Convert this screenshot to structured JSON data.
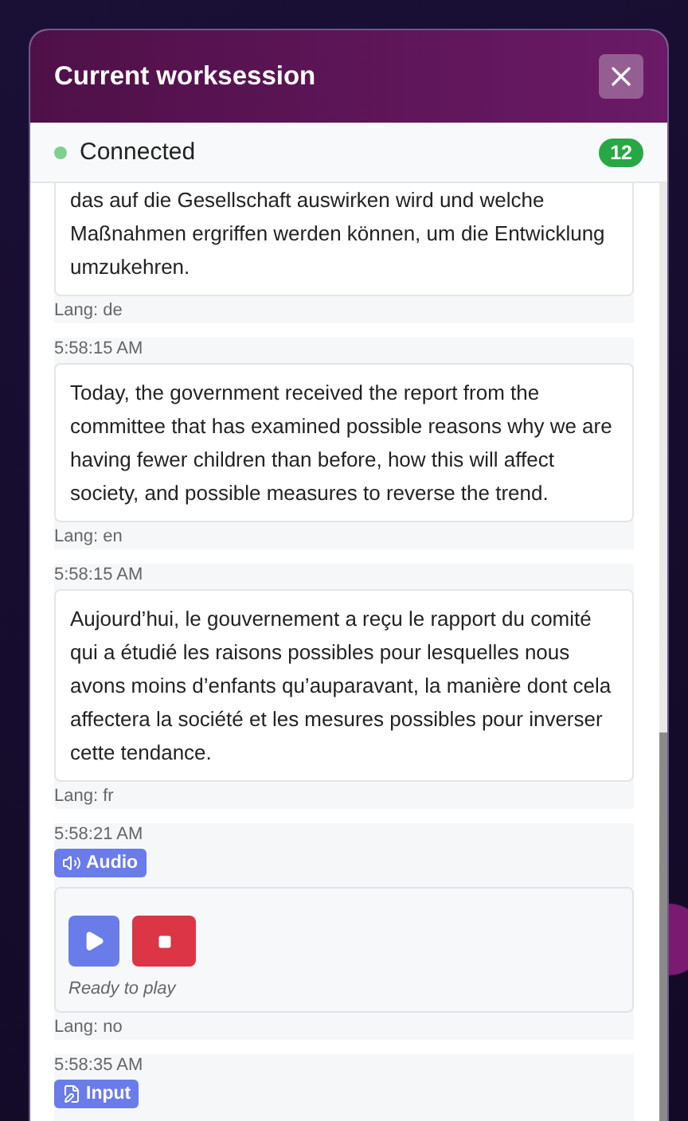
{
  "window": {
    "title": "Current worksession"
  },
  "status": {
    "label": "Connected",
    "connected": true,
    "count": "12"
  },
  "entries": [
    {
      "kind": "text",
      "text": "das auf die Gesellschaft auswirken wird und welche Maßnahmen ergriffen werden können, um die Entwicklung umzukehren.",
      "lang": "Lang: de"
    },
    {
      "kind": "text",
      "time": "5:58:15 AM",
      "text": "Today, the government received the report from the committee that has examined possible reasons why we are having fewer children than before, how this will affect society, and possible measures to reverse the trend.",
      "lang": "Lang: en"
    },
    {
      "kind": "text",
      "time": "5:58:15 AM",
      "text": "Aujourd’hui, le gouvernement a reçu le rapport du comité qui a étudié les raisons possibles pour lesquelles nous avons moins d’enfants qu’auparavant, la manière dont cela affectera la société et les mesures possibles pour inverser cette tendance.",
      "lang": "Lang: fr"
    },
    {
      "kind": "audio",
      "time": "5:58:21 AM",
      "badge": "Audio",
      "status": "Ready to play",
      "lang": "Lang: no"
    },
    {
      "kind": "input",
      "time": "5:58:35 AM",
      "badge": "Input"
    }
  ]
}
